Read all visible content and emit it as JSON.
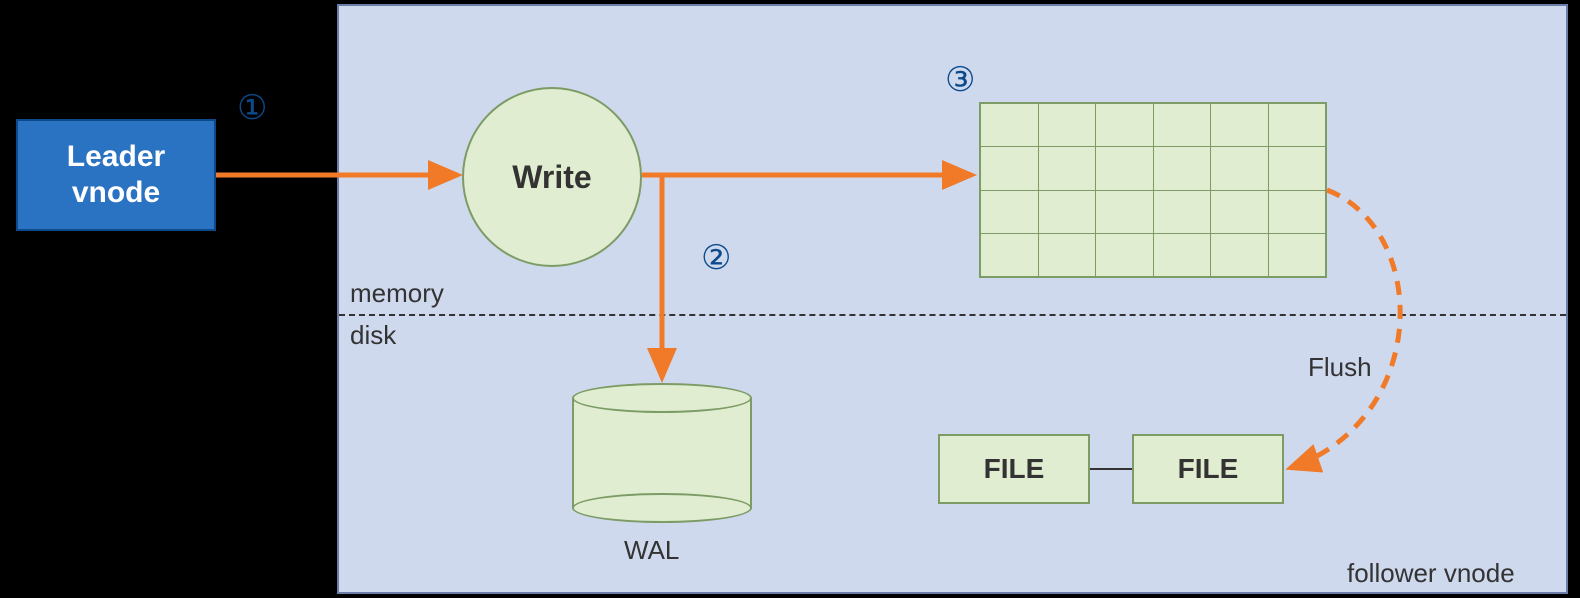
{
  "leader": {
    "label": "Leader\nvnode"
  },
  "write": {
    "label": "Write"
  },
  "labels": {
    "memory": "memory",
    "disk": "disk",
    "wal": "WAL",
    "flush": "Flush",
    "follower": "follower vnode"
  },
  "files": {
    "f1": "FILE",
    "f2": "FILE"
  },
  "steps": {
    "s1": "①",
    "s2": "②",
    "s3": "③"
  },
  "grid": {
    "rows": 4,
    "cols": 6
  },
  "colors": {
    "followerBg": "#cfd9ee",
    "leaderBg": "#2a72c2",
    "nodeFill": "#e0edd1",
    "nodeStroke": "#7c9b65",
    "arrow": "#f07a28"
  }
}
